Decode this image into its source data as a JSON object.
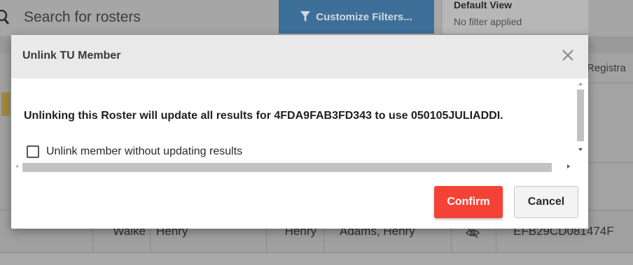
{
  "background": {
    "search_placeholder": "Search for rosters",
    "customize_filters_label": "Customize Filters...",
    "view_title": "Default View",
    "view_subtitle": "No filter applied",
    "column_header_partial": "Registra",
    "row": {
      "col_partial_name": "Walke",
      "first_name": "Henry",
      "preferred_name": "Henry",
      "full_name": "Adams, Henry",
      "id_partial": "EFB29CD081474F"
    }
  },
  "dialog": {
    "title": "Unlink TU Member",
    "message": "Unlinking this Roster will update all results for 4FDA9FAB3FD343 to use 050105JULIADDI.",
    "checkbox_label": "Unlink member without updating results",
    "checkbox_checked": false,
    "confirm_label": "Confirm",
    "cancel_label": "Cancel"
  },
  "icons": {
    "close": "close-icon",
    "search": "search-icon",
    "filter": "filter-icon",
    "visibility": "eye-off-icon"
  },
  "colors": {
    "confirm": "#f44336",
    "filter_button": "#3d6f98",
    "dialog_header": "#e9e9e9"
  }
}
